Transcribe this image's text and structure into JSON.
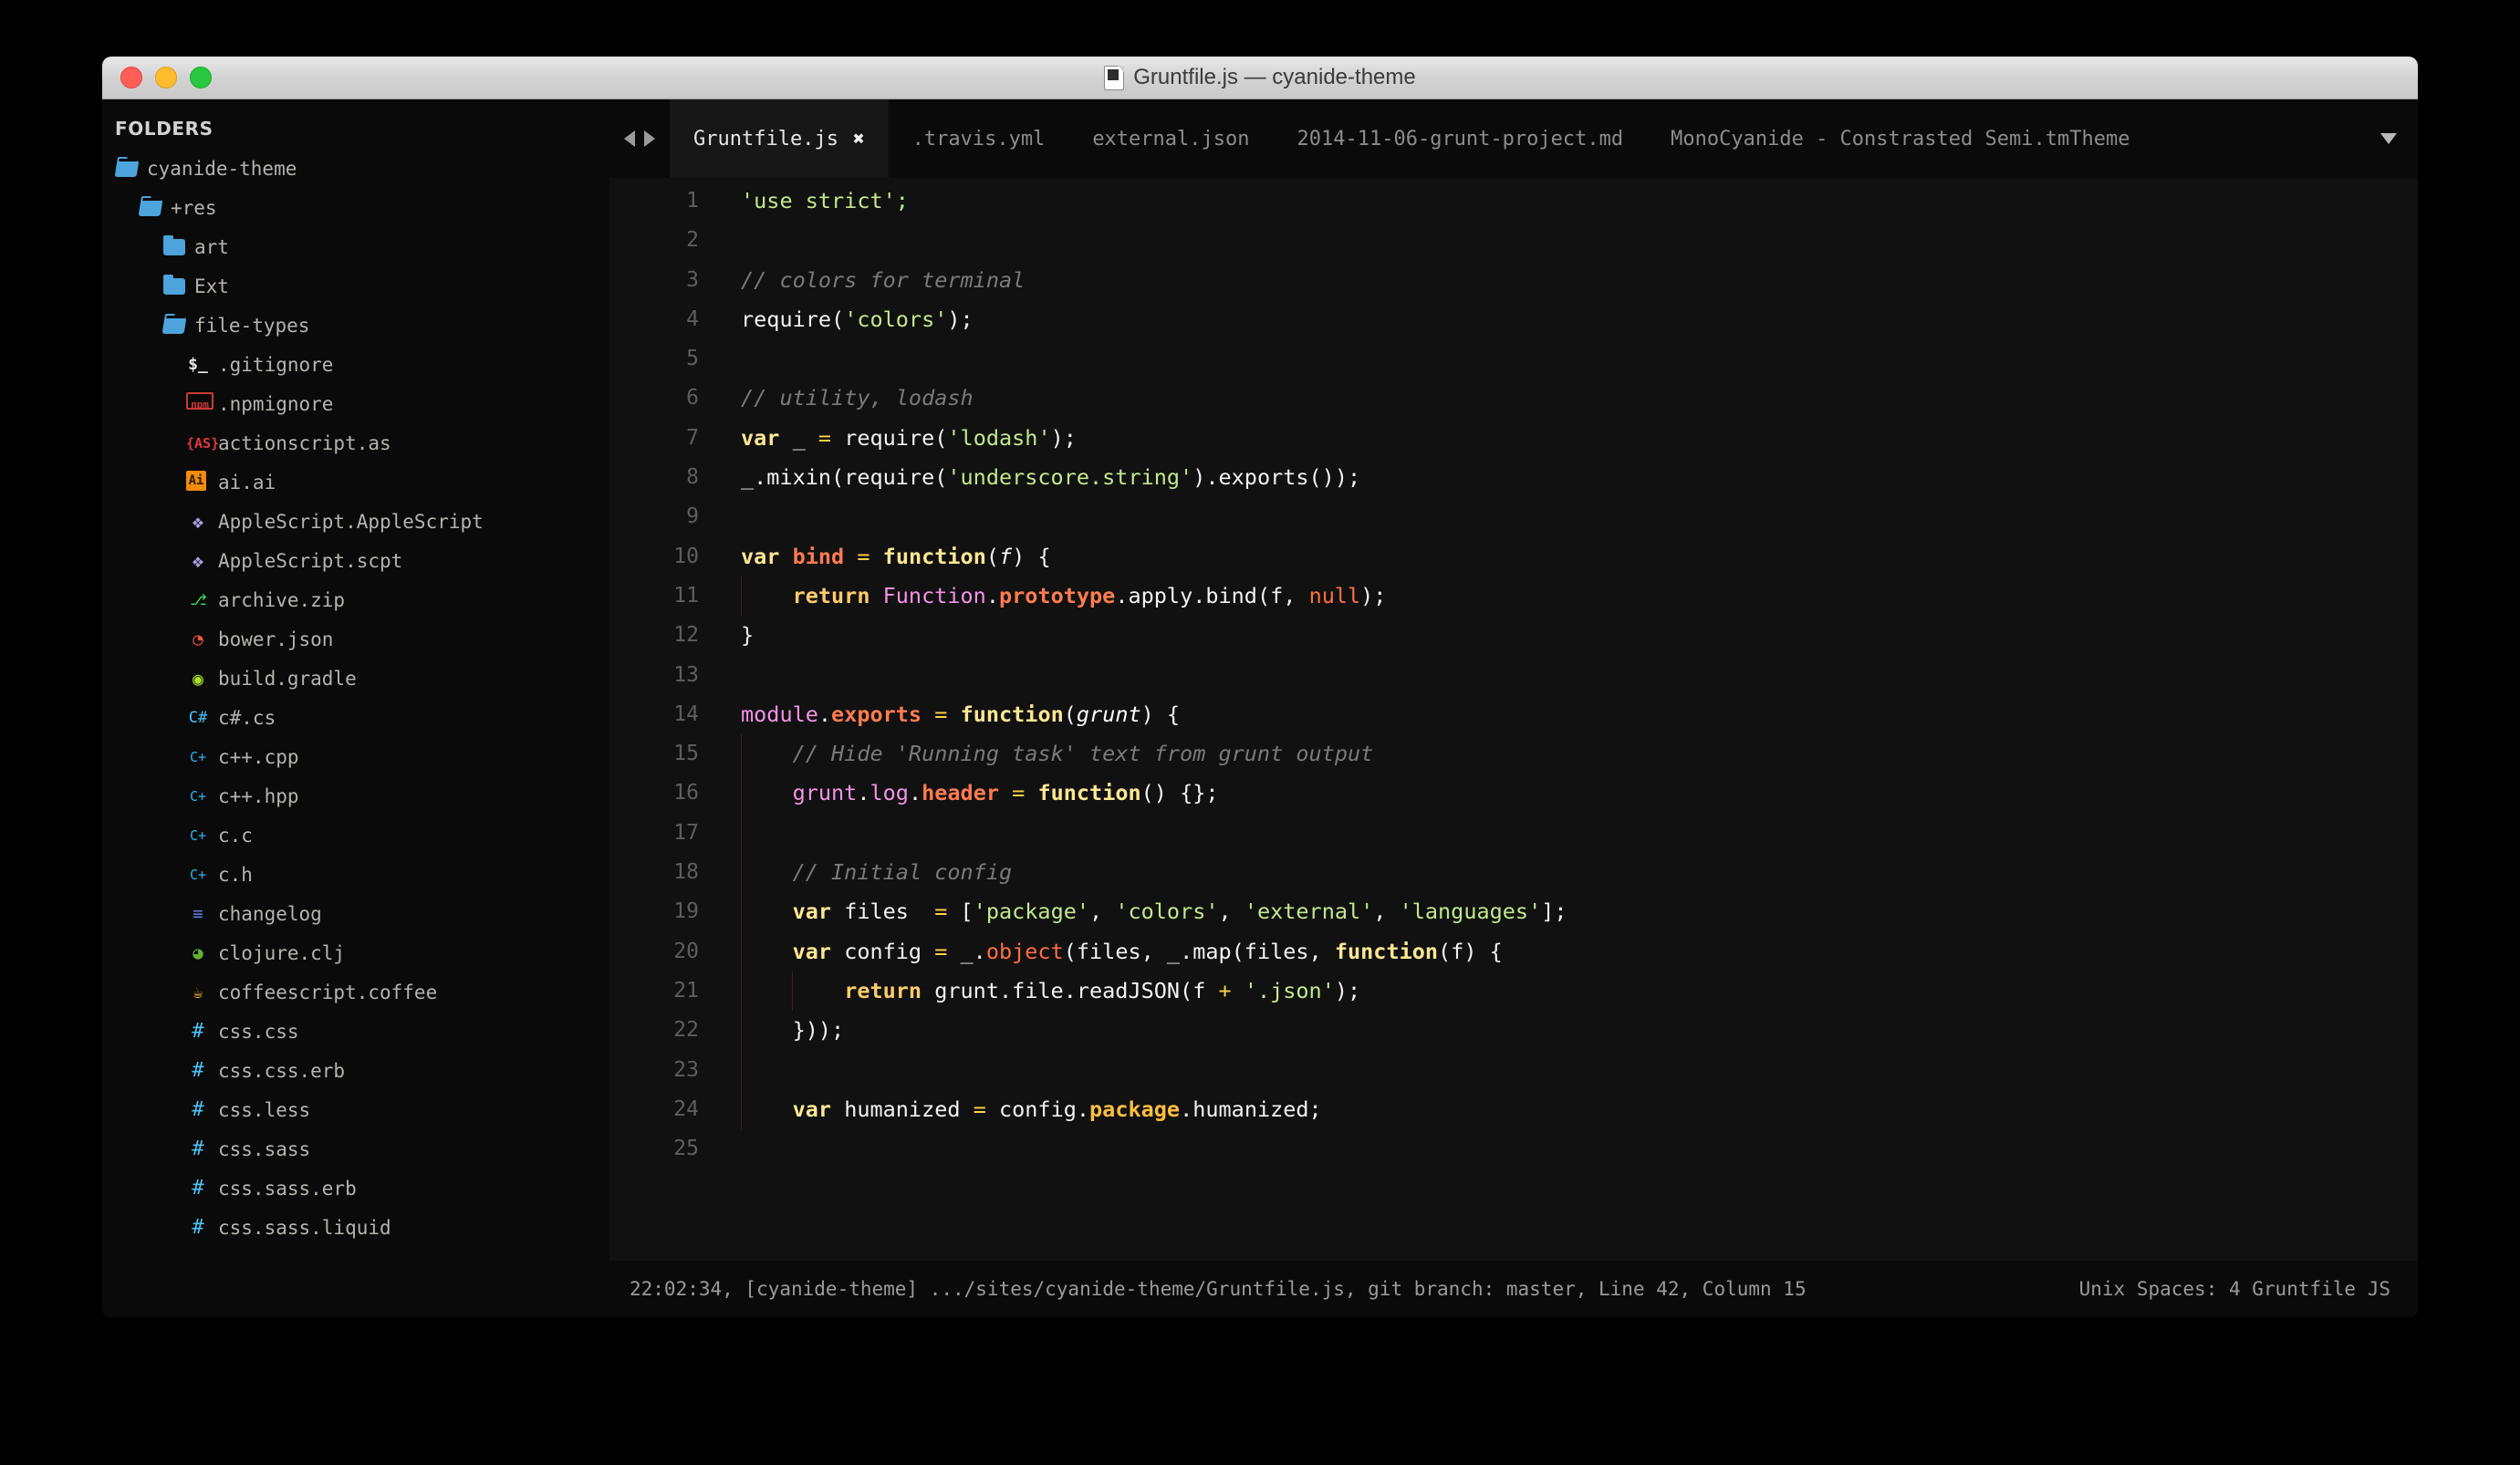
{
  "window": {
    "title": "Gruntfile.js — cyanide-theme",
    "traffic_lights": [
      "close",
      "minimize",
      "zoom"
    ]
  },
  "sidebar": {
    "header": "FOLDERS",
    "items": [
      {
        "label": "cyanide-theme",
        "icon": "folder-open-icon",
        "depth": 0,
        "kind": "folder-open"
      },
      {
        "label": "+res",
        "icon": "folder-open-icon",
        "depth": 1,
        "kind": "folder-open"
      },
      {
        "label": "art",
        "icon": "folder-icon",
        "depth": 2,
        "kind": "folder"
      },
      {
        "label": "Ext",
        "icon": "folder-icon",
        "depth": 2,
        "kind": "folder"
      },
      {
        "label": "file-types",
        "icon": "folder-open-icon",
        "depth": 2,
        "kind": "folder-open"
      },
      {
        "label": ".gitignore",
        "icon": "shell-icon",
        "depth": 3,
        "kind": "sh",
        "glyph": "$_"
      },
      {
        "label": ".npmignore",
        "icon": "npm-icon",
        "depth": 3,
        "kind": "npm",
        "glyph": "npm"
      },
      {
        "label": "actionscript.as",
        "icon": "actionscript-icon",
        "depth": 3,
        "kind": "as",
        "glyph": "{AS}"
      },
      {
        "label": "ai.ai",
        "icon": "illustrator-icon",
        "depth": 3,
        "kind": "ai",
        "glyph": "Ai"
      },
      {
        "label": "AppleScript.AppleScript",
        "icon": "applescript-icon",
        "depth": 3,
        "kind": "apple",
        "glyph": "❖"
      },
      {
        "label": "AppleScript.scpt",
        "icon": "applescript-icon",
        "depth": 3,
        "kind": "apple",
        "glyph": "❖"
      },
      {
        "label": "archive.zip",
        "icon": "archive-icon",
        "depth": 3,
        "kind": "zip",
        "glyph": "⎇"
      },
      {
        "label": "bower.json",
        "icon": "bower-icon",
        "depth": 3,
        "kind": "bower",
        "glyph": "◔"
      },
      {
        "label": "build.gradle",
        "icon": "gradle-icon",
        "depth": 3,
        "kind": "gradle",
        "glyph": "◉"
      },
      {
        "label": "c#.cs",
        "icon": "csharp-icon",
        "depth": 3,
        "kind": "cs",
        "glyph": "C#"
      },
      {
        "label": "c++.cpp",
        "icon": "cplusplus-icon",
        "depth": 3,
        "kind": "cpp",
        "glyph": "C+"
      },
      {
        "label": "c++.hpp",
        "icon": "cplusplus-icon",
        "depth": 3,
        "kind": "cpp",
        "glyph": "C+"
      },
      {
        "label": "c.c",
        "icon": "cplusplus-icon",
        "depth": 3,
        "kind": "cpp",
        "glyph": "C+"
      },
      {
        "label": "c.h",
        "icon": "cplusplus-icon",
        "depth": 3,
        "kind": "cpp",
        "glyph": "C+"
      },
      {
        "label": "changelog",
        "icon": "changelog-icon",
        "depth": 3,
        "kind": "log",
        "glyph": "≡"
      },
      {
        "label": "clojure.clj",
        "icon": "clojure-icon",
        "depth": 3,
        "kind": "clj",
        "glyph": "◕"
      },
      {
        "label": "coffeescript.coffee",
        "icon": "coffee-icon",
        "depth": 3,
        "kind": "coffee",
        "glyph": "☕"
      },
      {
        "label": "css.css",
        "icon": "css-icon",
        "depth": 3,
        "kind": "hash",
        "glyph": "#"
      },
      {
        "label": "css.css.erb",
        "icon": "css-icon",
        "depth": 3,
        "kind": "hash",
        "glyph": "#"
      },
      {
        "label": "css.less",
        "icon": "css-icon",
        "depth": 3,
        "kind": "hash",
        "glyph": "#"
      },
      {
        "label": "css.sass",
        "icon": "css-icon",
        "depth": 3,
        "kind": "hash",
        "glyph": "#"
      },
      {
        "label": "css.sass.erb",
        "icon": "css-icon",
        "depth": 3,
        "kind": "hash",
        "glyph": "#"
      },
      {
        "label": "css.sass.liquid",
        "icon": "css-icon",
        "depth": 3,
        "kind": "hash",
        "glyph": "#"
      }
    ]
  },
  "tabbar": {
    "prev_icon": "chevron-left-icon",
    "next_icon": "chevron-right-icon",
    "menu_icon": "chevron-down-icon",
    "close_glyph": "✖",
    "tabs": [
      {
        "label": "Gruntfile.js",
        "active": true,
        "closable": true
      },
      {
        "label": ".travis.yml",
        "active": false,
        "closable": false
      },
      {
        "label": "external.json",
        "active": false,
        "closable": false
      },
      {
        "label": "2014-11-06-grunt-project.md",
        "active": false,
        "closable": false
      },
      {
        "label": "MonoCyanide - Constrasted Semi.tmTheme",
        "active": false,
        "closable": false
      }
    ]
  },
  "editor": {
    "first_line": 1,
    "line_numbers": [
      1,
      2,
      3,
      4,
      5,
      6,
      7,
      8,
      9,
      10,
      11,
      12,
      13,
      14,
      15,
      16,
      17,
      18,
      19,
      20,
      21,
      22,
      23,
      24,
      25
    ],
    "lines": [
      {
        "n": 1,
        "tokens": [
          {
            "t": "'use strict';",
            "c": "s-str"
          }
        ]
      },
      {
        "n": 2,
        "tokens": []
      },
      {
        "n": 3,
        "tokens": [
          {
            "t": "// colors for terminal",
            "c": "s-com"
          }
        ]
      },
      {
        "n": 4,
        "tokens": [
          {
            "t": "require(",
            "c": "s-plain"
          },
          {
            "t": "'colors'",
            "c": "s-str"
          },
          {
            "t": ");",
            "c": "s-plain"
          }
        ]
      },
      {
        "n": 5,
        "tokens": []
      },
      {
        "n": 6,
        "tokens": [
          {
            "t": "// utility, lodash",
            "c": "s-com"
          }
        ]
      },
      {
        "n": 7,
        "tokens": [
          {
            "t": "var",
            "c": "s-kw"
          },
          {
            "t": " _ ",
            "c": "s-plain"
          },
          {
            "t": "=",
            "c": "s-op"
          },
          {
            "t": " require(",
            "c": "s-plain"
          },
          {
            "t": "'lodash'",
            "c": "s-str"
          },
          {
            "t": ");",
            "c": "s-plain"
          }
        ]
      },
      {
        "n": 8,
        "tokens": [
          {
            "t": "_.mixin(require(",
            "c": "s-plain"
          },
          {
            "t": "'underscore.string'",
            "c": "s-str"
          },
          {
            "t": ").exports());",
            "c": "s-plain"
          }
        ]
      },
      {
        "n": 9,
        "tokens": []
      },
      {
        "n": 10,
        "tokens": [
          {
            "t": "var",
            "c": "s-kw"
          },
          {
            "t": " ",
            "c": "s-plain"
          },
          {
            "t": "bind",
            "c": "s-var"
          },
          {
            "t": " ",
            "c": "s-plain"
          },
          {
            "t": "=",
            "c": "s-op"
          },
          {
            "t": " ",
            "c": "s-plain"
          },
          {
            "t": "function",
            "c": "s-fn"
          },
          {
            "t": "(",
            "c": "s-plain"
          },
          {
            "t": "f",
            "c": "s-param"
          },
          {
            "t": ") {",
            "c": "s-plain"
          }
        ]
      },
      {
        "n": 11,
        "tokens": [
          {
            "t": "    ",
            "c": "s-plain"
          },
          {
            "t": "return",
            "c": "s-kw2"
          },
          {
            "t": " ",
            "c": "s-plain"
          },
          {
            "t": "Function",
            "c": "s-cls"
          },
          {
            "t": ".",
            "c": "s-plain"
          },
          {
            "t": "prototype",
            "c": "s-var"
          },
          {
            "t": ".apply.bind(f, ",
            "c": "s-plain"
          },
          {
            "t": "null",
            "c": "s-const"
          },
          {
            "t": ");",
            "c": "s-plain"
          }
        ]
      },
      {
        "n": 12,
        "tokens": [
          {
            "t": "}",
            "c": "s-plain"
          }
        ]
      },
      {
        "n": 13,
        "tokens": []
      },
      {
        "n": 14,
        "tokens": [
          {
            "t": "module",
            "c": "s-cls"
          },
          {
            "t": ".",
            "c": "s-plain"
          },
          {
            "t": "exports",
            "c": "s-var"
          },
          {
            "t": " ",
            "c": "s-plain"
          },
          {
            "t": "=",
            "c": "s-op"
          },
          {
            "t": " ",
            "c": "s-plain"
          },
          {
            "t": "function",
            "c": "s-fn"
          },
          {
            "t": "(",
            "c": "s-plain"
          },
          {
            "t": "grunt",
            "c": "s-param"
          },
          {
            "t": ") {",
            "c": "s-plain"
          }
        ]
      },
      {
        "n": 15,
        "tokens": [
          {
            "t": "    ",
            "c": "s-plain"
          },
          {
            "t": "// Hide 'Running task' text from grunt output",
            "c": "s-com"
          }
        ]
      },
      {
        "n": 16,
        "tokens": [
          {
            "t": "    ",
            "c": "s-plain"
          },
          {
            "t": "grunt",
            "c": "s-cls"
          },
          {
            "t": ".",
            "c": "s-plain"
          },
          {
            "t": "log",
            "c": "s-cls"
          },
          {
            "t": ".",
            "c": "s-plain"
          },
          {
            "t": "header",
            "c": "s-var"
          },
          {
            "t": " ",
            "c": "s-plain"
          },
          {
            "t": "=",
            "c": "s-op"
          },
          {
            "t": " ",
            "c": "s-plain"
          },
          {
            "t": "function",
            "c": "s-fn"
          },
          {
            "t": "() {};",
            "c": "s-plain"
          }
        ]
      },
      {
        "n": 17,
        "tokens": []
      },
      {
        "n": 18,
        "tokens": [
          {
            "t": "    ",
            "c": "s-plain"
          },
          {
            "t": "// Initial config",
            "c": "s-com"
          }
        ]
      },
      {
        "n": 19,
        "tokens": [
          {
            "t": "    ",
            "c": "s-plain"
          },
          {
            "t": "var",
            "c": "s-kw"
          },
          {
            "t": " files  ",
            "c": "s-plain"
          },
          {
            "t": "=",
            "c": "s-op"
          },
          {
            "t": " [",
            "c": "s-plain"
          },
          {
            "t": "'package'",
            "c": "s-str"
          },
          {
            "t": ", ",
            "c": "s-plain"
          },
          {
            "t": "'colors'",
            "c": "s-str"
          },
          {
            "t": ", ",
            "c": "s-plain"
          },
          {
            "t": "'external'",
            "c": "s-str"
          },
          {
            "t": ", ",
            "c": "s-plain"
          },
          {
            "t": "'languages'",
            "c": "s-str"
          },
          {
            "t": "];",
            "c": "s-plain"
          }
        ]
      },
      {
        "n": 20,
        "tokens": [
          {
            "t": "    ",
            "c": "s-plain"
          },
          {
            "t": "var",
            "c": "s-kw"
          },
          {
            "t": " config ",
            "c": "s-plain"
          },
          {
            "t": "=",
            "c": "s-op"
          },
          {
            "t": " _.",
            "c": "s-plain"
          },
          {
            "t": "object",
            "c": "s-const"
          },
          {
            "t": "(files, _.map(files, ",
            "c": "s-plain"
          },
          {
            "t": "function",
            "c": "s-fn"
          },
          {
            "t": "(f) {",
            "c": "s-plain"
          }
        ]
      },
      {
        "n": 21,
        "tokens": [
          {
            "t": "        ",
            "c": "s-plain"
          },
          {
            "t": "return",
            "c": "s-kw2"
          },
          {
            "t": " grunt.file.readJSON(f ",
            "c": "s-plain"
          },
          {
            "t": "+",
            "c": "s-op"
          },
          {
            "t": " ",
            "c": "s-plain"
          },
          {
            "t": "'.json'",
            "c": "s-str"
          },
          {
            "t": ");",
            "c": "s-plain"
          }
        ]
      },
      {
        "n": 22,
        "tokens": [
          {
            "t": "    }));",
            "c": "s-plain"
          }
        ]
      },
      {
        "n": 23,
        "tokens": []
      },
      {
        "n": 24,
        "tokens": [
          {
            "t": "    ",
            "c": "s-plain"
          },
          {
            "t": "var",
            "c": "s-kw"
          },
          {
            "t": " humanized ",
            "c": "s-plain"
          },
          {
            "t": "=",
            "c": "s-op"
          },
          {
            "t": " config.",
            "c": "s-plain"
          },
          {
            "t": "package",
            "c": "s-prop"
          },
          {
            "t": ".humanized;",
            "c": "s-plain"
          }
        ]
      },
      {
        "n": 25,
        "tokens": []
      }
    ]
  },
  "status": {
    "left": "22:02:34, [cyanide-theme] .../sites/cyanide-theme/Gruntfile.js, git branch: master, Line 42, Column 15",
    "right": "Unix Spaces: 4 Gruntfile JS"
  },
  "colors": {
    "background": "#0d0d0d",
    "editor_bg": "#111111",
    "sidebar_bg": "#0a0a0a",
    "string": "#c3e88d",
    "comment": "#7a7a7a",
    "keyword": "#ffe792",
    "variable": "#ff7b4f",
    "class": "#f492e8",
    "constant": "#ff6e40",
    "operator": "#ffd24a",
    "property": "#ffbf40",
    "foreground": "#f2f2f2",
    "folder_icon": "#4da3db"
  }
}
